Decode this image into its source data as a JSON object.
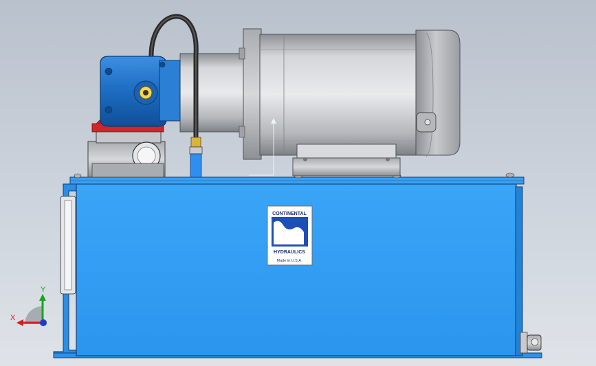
{
  "scene": {
    "background_top": "#b9c1cc",
    "background_bottom": "#dfe3e8",
    "tank_color": "#2f9cf5",
    "pump_color": "#1f72c9",
    "motor_color": "#c9cbce",
    "gear_red": "#d0262b"
  },
  "label_plate": {
    "line1": "CONTINENTAL",
    "line2": "HYDRAULICS",
    "line3": "Made in U.S.A."
  },
  "triad": {
    "x_label": "X",
    "y_label": "Y",
    "x_color": "#d21e1e",
    "y_color": "#16a51c",
    "z_color": "#1e3cc8"
  }
}
